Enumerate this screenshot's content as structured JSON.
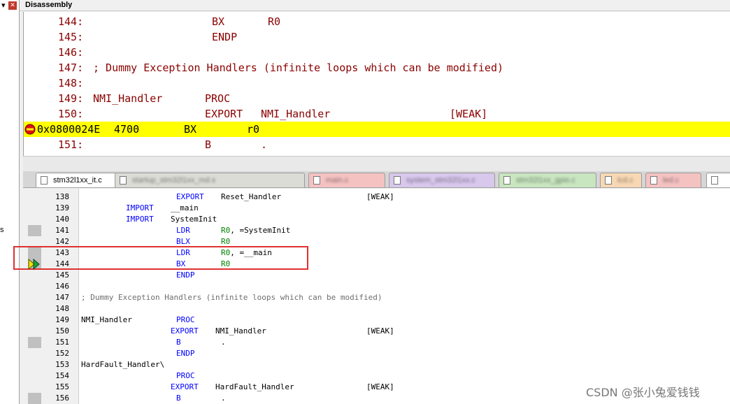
{
  "window": {
    "title": "Disassembly",
    "left_fragment": "s"
  },
  "disassembly": {
    "lines": [
      {
        "num": "144:",
        "label": "",
        "op": "BX",
        "arg": "R0",
        "extra": ""
      },
      {
        "num": "145:",
        "label": "",
        "op": "ENDP",
        "arg": "",
        "extra": ""
      },
      {
        "num": "146:",
        "label": "",
        "op": "",
        "arg": "",
        "extra": ""
      },
      {
        "num": "147:",
        "text": "; Dummy Exception Handlers (infinite loops which can be modified)"
      },
      {
        "num": "148:",
        "label": "",
        "op": "",
        "arg": "",
        "extra": ""
      },
      {
        "num": "149:",
        "label": "NMI_Handler",
        "op": "PROC",
        "arg": "",
        "extra": ""
      },
      {
        "num": "150:",
        "label": "",
        "op": "EXPORT",
        "arg": "NMI_Handler",
        "extra": "[WEAK]"
      },
      {
        "num": "151:",
        "label": "",
        "op": "B",
        "arg": ".",
        "extra": ""
      }
    ],
    "current": {
      "address": "0x0800024E",
      "opcode": "4700",
      "mnemonic": "BX",
      "operand": "r0"
    }
  },
  "tabs": [
    {
      "label": "stm32l1xx_it.c",
      "active": true,
      "color": "#ffffff"
    },
    {
      "label": "startup_stm32l1xx_md.s",
      "active": false,
      "color": "#dcdcd6"
    },
    {
      "label": "main.c",
      "active": false,
      "color": "#f5c2c2"
    },
    {
      "label": "system_stm32l1xx.c",
      "active": false,
      "color": "#d7c8ec"
    },
    {
      "label": "stm32l1xx_gpio.c",
      "active": false,
      "color": "#c8e6c0"
    },
    {
      "label": "lcd.c",
      "active": false,
      "color": "#f8d8b4"
    },
    {
      "label": "led.c",
      "active": false,
      "color": "#f5c2c2"
    }
  ],
  "source": {
    "lines": [
      {
        "n": "138",
        "label": "",
        "op": "EXPORT",
        "arg": "Reset_Handler",
        "weak": "[WEAK]",
        "style": "export"
      },
      {
        "n": "139",
        "label": "",
        "op": "IMPORT",
        "arg": "__main",
        "weak": "",
        "style": "import"
      },
      {
        "n": "140",
        "label": "",
        "op": "IMPORT",
        "arg": "SystemInit",
        "weak": "",
        "style": "import"
      },
      {
        "n": "141",
        "label": "",
        "op": "LDR",
        "arg": "R0, =SystemInit",
        "weak": "",
        "style": "ldr",
        "mark": true
      },
      {
        "n": "142",
        "label": "",
        "op": "BLX",
        "arg": "R0",
        "weak": "",
        "style": "reg"
      },
      {
        "n": "143",
        "label": "",
        "op": "LDR",
        "arg": "R0, =__main",
        "weak": "",
        "style": "ldr",
        "mark": true
      },
      {
        "n": "144",
        "label": "",
        "op": "BX",
        "arg": "R0",
        "weak": "",
        "style": "reg",
        "mark": true
      },
      {
        "n": "145",
        "label": "",
        "op": "ENDP",
        "arg": "",
        "weak": "",
        "style": "kw"
      },
      {
        "n": "146",
        "label": "",
        "op": "",
        "arg": "",
        "weak": "",
        "style": "none"
      },
      {
        "n": "147",
        "comment": "; Dummy Exception Handlers (infinite loops which can be modified)"
      },
      {
        "n": "148",
        "label": "",
        "op": "",
        "arg": "",
        "weak": "",
        "style": "none"
      },
      {
        "n": "149",
        "label": "NMI_Handler",
        "op": "PROC",
        "arg": "",
        "weak": "",
        "style": "kw"
      },
      {
        "n": "150",
        "label": "",
        "op": "EXPORT",
        "arg": "NMI_Handler",
        "weak": "[WEAK]",
        "style": "export"
      },
      {
        "n": "151",
        "label": "",
        "op": "B",
        "arg": ".",
        "weak": "",
        "style": "kw",
        "mark": true
      },
      {
        "n": "152",
        "label": "",
        "op": "ENDP",
        "arg": "",
        "weak": "",
        "style": "kw"
      },
      {
        "n": "153",
        "label": "HardFault_Handler\\",
        "op": "",
        "arg": "",
        "weak": "",
        "style": "none"
      },
      {
        "n": "154",
        "label": "",
        "op": "PROC",
        "arg": "",
        "weak": "",
        "style": "kw"
      },
      {
        "n": "155",
        "label": "",
        "op": "EXPORT",
        "arg": "HardFault_Handler",
        "weak": "[WEAK]",
        "style": "export"
      },
      {
        "n": "156",
        "label": "",
        "op": "B",
        "arg": ".",
        "weak": "",
        "style": "kw",
        "mark": true
      }
    ]
  },
  "watermark": "CSDN @张小兔爱钱钱",
  "colors": {
    "highlight": "#ffff00",
    "keyword": "#0000ff",
    "register": "#008000",
    "disasm_text": "#8b0000",
    "annotation": "#e03030"
  },
  "icons": {
    "pin": "pin-icon",
    "close": "close-icon",
    "current_instruction": "current-instruction-arrow-icon",
    "execution": "execution-arrow-icon"
  }
}
